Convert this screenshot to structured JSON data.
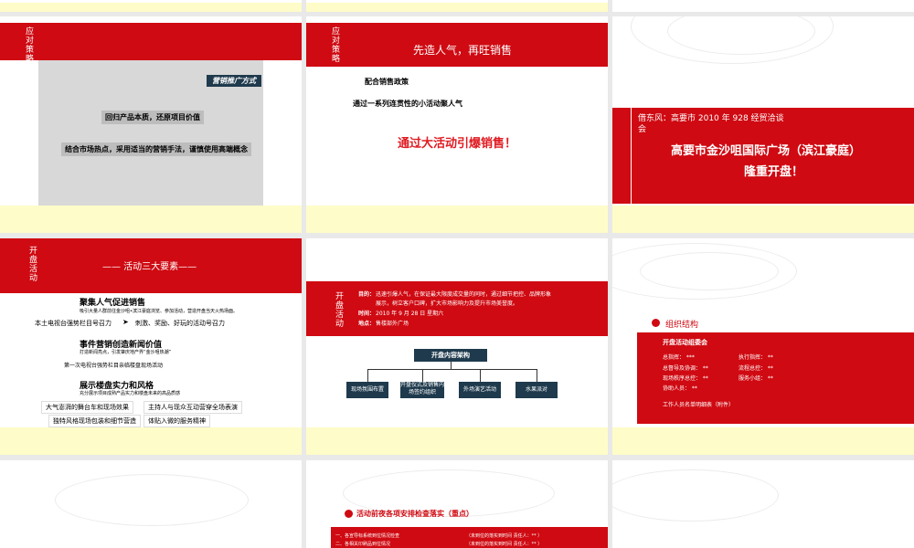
{
  "slide1": {
    "side_label": "应对策略",
    "badge": "营销推广方式",
    "line1": "回归产品本质，还原项目价值",
    "line2": "结合市场热点，采用适当的营销手法，谨慎使用高端概念"
  },
  "slide2": {
    "side_label": "应对策略",
    "title": "先造人气，再旺销售",
    "policy": "配合销售政策",
    "activity": "通过一系列连贯性的小活动聚人气",
    "headline": "通过大活动引爆销售！"
  },
  "slide3": {
    "line1": "借东风：高要市 2010 年 928 经贸洽谈",
    "line2": "会",
    "title1": "高要市金沙咀国际广场（滨江豪庭）",
    "title2": "隆重开盘！"
  },
  "slide4": {
    "side_label": "开盘活动",
    "title": "—— 活动三大要素——",
    "s1_title": "聚集人气促进销售",
    "s1_sub": "吸引大量人群前往金沙咀•滨江豪庭浏览、参加活动，营造开盘当天火热场面。",
    "s1_left": "本土电视台强势栏目号召力",
    "s1_right": "刺激、奖励、好玩的活动号召力",
    "s2_title": "事件营销创造新闻价值",
    "s2_sub": "打造新闻亮点，引发肇庆地产界“金沙咀热潮”",
    "s2_line": "第一次电视台强势栏目亲临楼盘现场活动",
    "s3_title": "展示楼盘实力和风格",
    "s3_sub": "充分展示项目成熟产品实力和楼盘未来的高品质感",
    "s3_b1": "大气澎湃的舞台车和现场效果",
    "s3_b2": "主持人与现众互动营穿全场表演",
    "s3_b3": "独特风格现场包装和细节营造",
    "s3_b4": "体贴入微的服务精神"
  },
  "slide5": {
    "side_label": "开盘活动",
    "purpose_label": "目的：",
    "purpose_text1": "迅速引爆人气，在保证最大限度成交量的同时，通过细节把控、品牌形象",
    "purpose_text2": "展示，树立客户口碑，扩大市场影响力及提升市场美誉度。",
    "time_label": "时间：",
    "time_text": "2010 年 9 月 28 日 星期六",
    "place_label": "地点：",
    "place_text": "售楼部外广场",
    "arch_title": "开盘内容架构",
    "nodes": [
      "现场氛围布置",
      "开盘仪式及销售内场签约组织",
      "外场演艺活动",
      "水果派对"
    ]
  },
  "slide6": {
    "section": "组织结构",
    "committee": "开盘活动组委会",
    "rows": [
      [
        "总指挥：  ***",
        "执行指挥：  **"
      ],
      [
        "总督导及协调：  **",
        "流程总控：  **"
      ],
      [
        "现场秩序总控：  **",
        "服务小组：  **"
      ],
      [
        "协助人员：  **",
        ""
      ]
    ],
    "footer": "工作人员名单明细表（附件）"
  },
  "slide8": {
    "section": "活动前夜各项安排检查落实（重点）",
    "row1_left": "一、各宣导标系统到位情况检查",
    "row1_right": "（未到位的落实到时间  责任人：** ）",
    "row2_left": "二、各相关印刷品到位情况",
    "row2_right": "（未到位的落实到时间  责任人：** ）"
  },
  "colors": {
    "red": "#cf0a12",
    "cream": "#fefcc8",
    "navy": "#1f3a4d"
  }
}
